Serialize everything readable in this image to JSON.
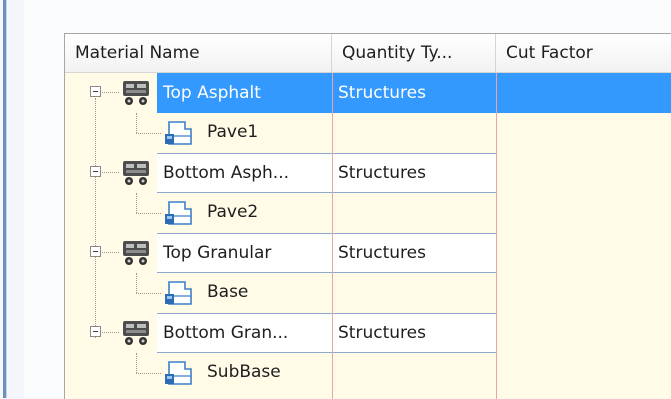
{
  "grid": {
    "columns": [
      {
        "label": "Material Name"
      },
      {
        "label": "Quantity Ty..."
      },
      {
        "label": "Cut Factor"
      }
    ],
    "rows": [
      {
        "kind": "parent",
        "name": "Top Asphalt",
        "quantity_type": "Structures",
        "selected": true,
        "icon": "material-icon"
      },
      {
        "kind": "child",
        "name": "Pave1",
        "icon": "shape-icon"
      },
      {
        "kind": "parent",
        "name": "Bottom Asph...",
        "quantity_type": "Structures",
        "selected": false,
        "icon": "material-icon"
      },
      {
        "kind": "child",
        "name": "Pave2",
        "icon": "shape-icon"
      },
      {
        "kind": "parent",
        "name": "Top Granular",
        "quantity_type": "Structures",
        "selected": false,
        "icon": "material-icon"
      },
      {
        "kind": "child",
        "name": "Base",
        "icon": "shape-icon"
      },
      {
        "kind": "parent",
        "name": "Bottom Gran...",
        "quantity_type": "Structures",
        "selected": false,
        "icon": "material-icon"
      },
      {
        "kind": "child",
        "name": "SubBase",
        "icon": "shape-icon"
      }
    ]
  },
  "colors": {
    "selection": "#3399ff",
    "child_background": "#fffbe6",
    "column_divider": "#e9a6a6"
  }
}
